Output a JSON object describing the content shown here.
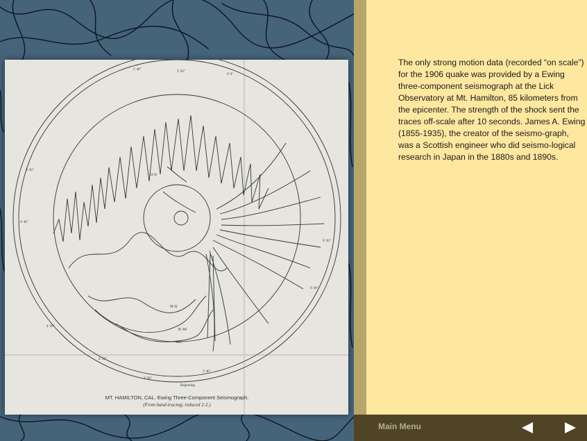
{
  "figure": {
    "caption_line1": "MT. HAMILTON, CAL.   Ewing Three-Component Seismograph.",
    "caption_line2": "(From hand-tracing; reduced 1:2.)",
    "labels": {
      "ns": "N-S",
      "ew": "E-W",
      "vert": "Vert",
      "beginning": "Beginning"
    }
  },
  "text": {
    "caption": "The only strong motion data (recorded “on scale”) for the 1906 quake was provided by a Ewing three-component seismograph at the Lick Observatory at Mt. Hamilton, 85 kilometers from the epicenter. The strength of the shock sent the traces off-scale after 10 seconds. James A. Ewing (1855-1935), the creator of the seismo-graph, was a Scottish engineer who did seismo-logical research in Japan in the 1880s and 1890s."
  },
  "footer": {
    "main_menu_label": "Main Menu",
    "prev_icon": "left-triangle",
    "next_icon": "right-triangle"
  },
  "colors": {
    "left_bg": "#456379",
    "right_bg": "#fee8a0",
    "divider": "#b7a56a",
    "footer_bg": "#4f4425"
  }
}
